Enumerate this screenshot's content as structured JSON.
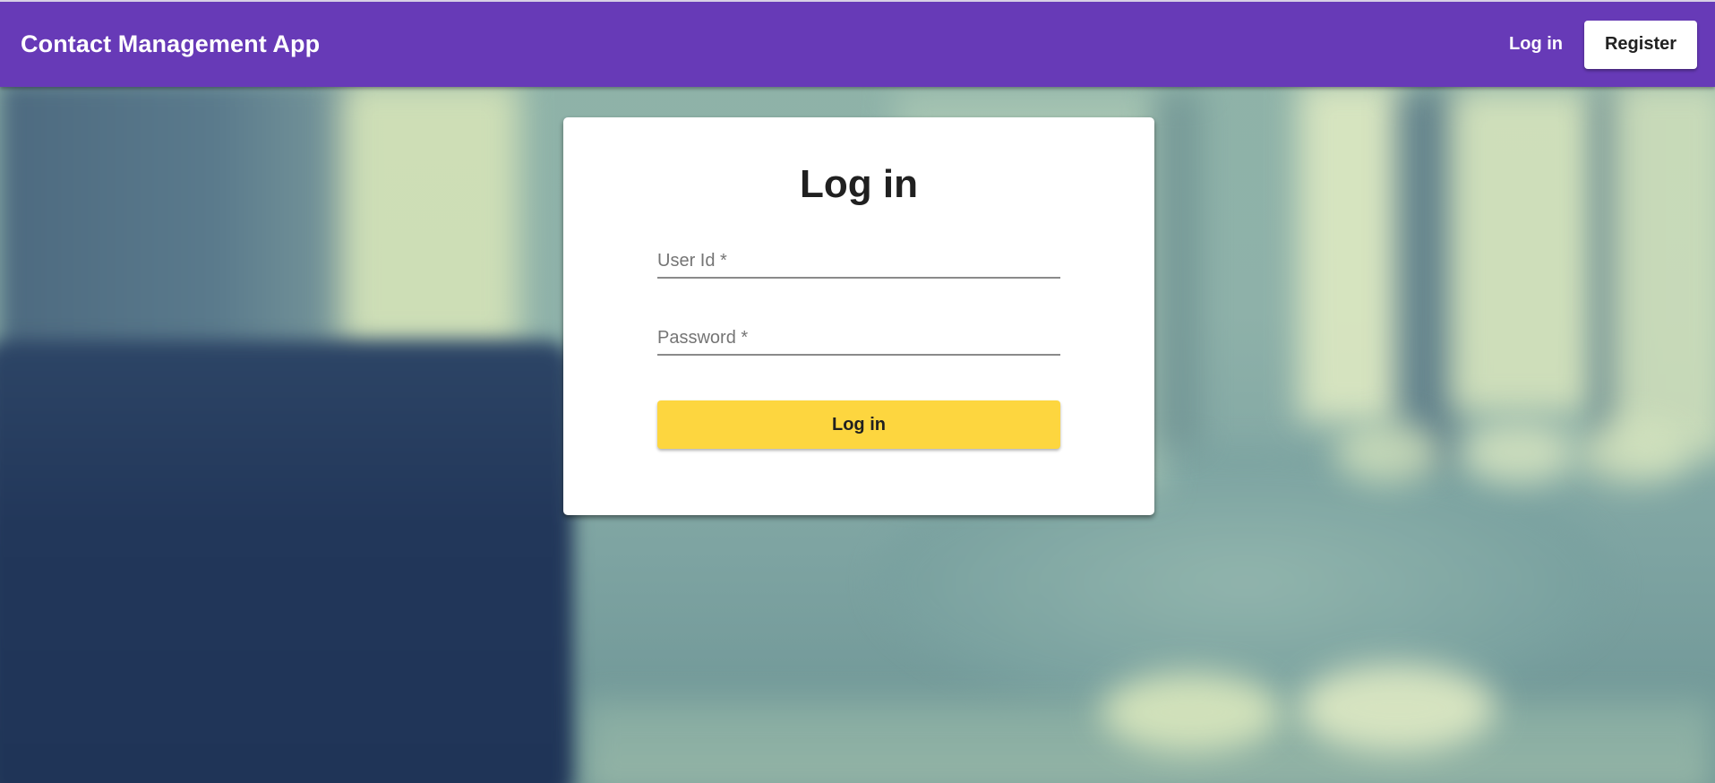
{
  "header": {
    "title": "Contact Management App",
    "login_label": "Log in",
    "register_label": "Register"
  },
  "login_card": {
    "title": "Log in",
    "user_id_placeholder": "User Id *",
    "password_placeholder": "Password *",
    "submit_label": "Log in"
  },
  "colors": {
    "app_bar": "#673ab7",
    "submit_button": "#fdd63f",
    "card": "#ffffff"
  }
}
